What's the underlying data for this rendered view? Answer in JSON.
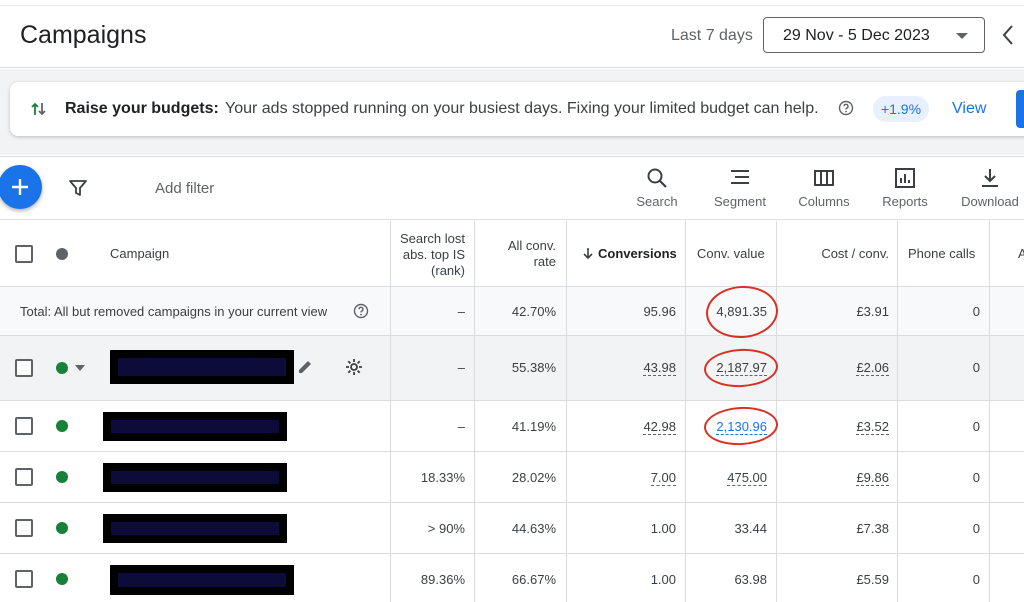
{
  "header": {
    "title": "Campaigns",
    "range_label": "Last 7 days",
    "date_range": "29 Nov - 5 Dec 2023"
  },
  "banner": {
    "title": "Raise your budgets:",
    "text": "Your ads stopped running on your busiest days. Fixing your limited budget can help.",
    "badge": "+1.9%",
    "view": "View"
  },
  "toolbar": {
    "add_filter": "Add filter",
    "tools": [
      "Search",
      "Segment",
      "Columns",
      "Reports",
      "Download"
    ]
  },
  "table": {
    "headers": {
      "campaign": "Campaign",
      "search_lost_1": "Search lost",
      "search_lost_2": "abs. top IS",
      "search_lost_3": "(rank)",
      "all_conv_1": "All conv.",
      "all_conv_2": "rate",
      "conversions": "Conversions",
      "conv_value": "Conv. value",
      "cost_conv": "Cost / conv.",
      "phone_calls": "Phone calls"
    },
    "total": {
      "label": "Total: All but removed campaigns in your current view",
      "search_lost": "–",
      "all_conv_rate": "42.70%",
      "conversions": "95.96",
      "conv_value": "4,891.35",
      "cost_conv": "£3.91",
      "phone_calls": "0"
    },
    "rows": [
      {
        "search_lost": "–",
        "all_conv_rate": "55.38%",
        "conversions": "43.98",
        "conv_value": "2,187.97",
        "cost_conv": "£2.06",
        "phone_calls": "0"
      },
      {
        "search_lost": "–",
        "all_conv_rate": "41.19%",
        "conversions": "42.98",
        "conv_value": "2,130.96",
        "cost_conv": "£3.52",
        "phone_calls": "0"
      },
      {
        "search_lost": "18.33%",
        "all_conv_rate": "28.02%",
        "conversions": "7.00",
        "conv_value": "475.00",
        "cost_conv": "£9.86",
        "phone_calls": "0"
      },
      {
        "search_lost": "> 90%",
        "all_conv_rate": "44.63%",
        "conversions": "1.00",
        "conv_value": "33.44",
        "cost_conv": "£7.38",
        "phone_calls": "0"
      },
      {
        "search_lost": "89.36%",
        "all_conv_rate": "66.67%",
        "conversions": "1.00",
        "conv_value": "63.98",
        "cost_conv": "£5.59",
        "phone_calls": "0"
      }
    ]
  },
  "colors": {
    "accent": "#1a73e8",
    "status_enabled": "#188038",
    "annotation": "#d93025"
  }
}
